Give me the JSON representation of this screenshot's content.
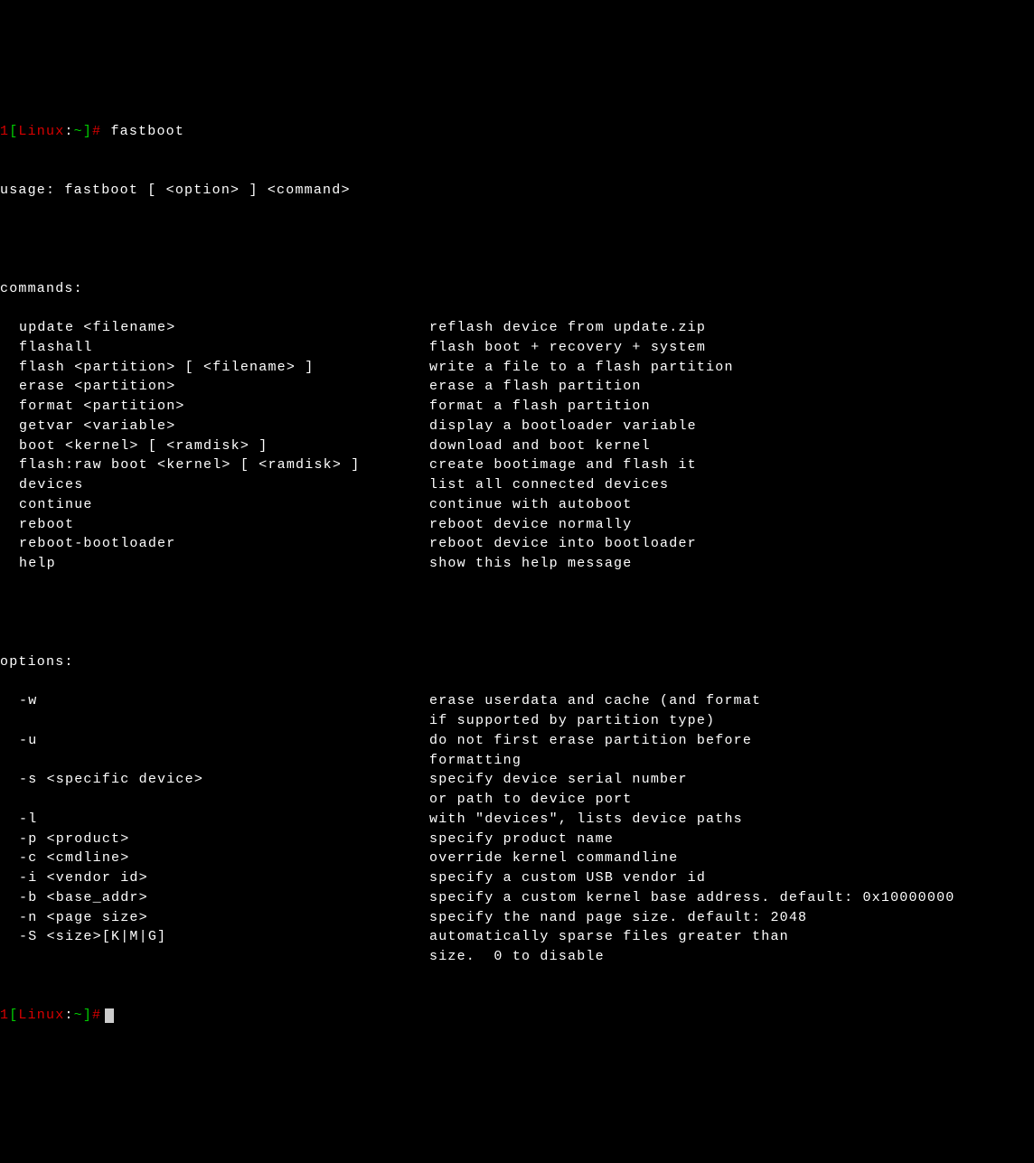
{
  "prompt": {
    "num": "1",
    "open": "[",
    "host": "Linux",
    "sep": ":",
    "path": "~",
    "close": "]",
    "hash": "#"
  },
  "cmd1": "fastboot",
  "usage": "usage: fastboot [ <option> ] <command>",
  "commands_header": "commands:",
  "commands": [
    {
      "left": "update <filename>",
      "right": "reflash device from update.zip"
    },
    {
      "left": "flashall",
      "right": "flash boot + recovery + system"
    },
    {
      "left": "flash <partition> [ <filename> ]",
      "right": "write a file to a flash partition"
    },
    {
      "left": "erase <partition>",
      "right": "erase a flash partition"
    },
    {
      "left": "format <partition>",
      "right": "format a flash partition"
    },
    {
      "left": "getvar <variable>",
      "right": "display a bootloader variable"
    },
    {
      "left": "boot <kernel> [ <ramdisk> ]",
      "right": "download and boot kernel"
    },
    {
      "left": "flash:raw boot <kernel> [ <ramdisk> ]",
      "right": "create bootimage and flash it"
    },
    {
      "left": "devices",
      "right": "list all connected devices"
    },
    {
      "left": "continue",
      "right": "continue with autoboot"
    },
    {
      "left": "reboot",
      "right": "reboot device normally"
    },
    {
      "left": "reboot-bootloader",
      "right": "reboot device into bootloader"
    },
    {
      "left": "help",
      "right": "show this help message"
    }
  ],
  "options_header": "options:",
  "options": [
    {
      "left": "-w",
      "right": "erase userdata and cache (and format"
    },
    {
      "left": "",
      "right": "if supported by partition type)"
    },
    {
      "left": "-u",
      "right": "do not first erase partition before"
    },
    {
      "left": "",
      "right": "formatting"
    },
    {
      "left": "-s <specific device>",
      "right": "specify device serial number"
    },
    {
      "left": "",
      "right": "or path to device port"
    },
    {
      "left": "-l",
      "right": "with \"devices\", lists device paths"
    },
    {
      "left": "-p <product>",
      "right": "specify product name"
    },
    {
      "left": "-c <cmdline>",
      "right": "override kernel commandline"
    },
    {
      "left": "-i <vendor id>",
      "right": "specify a custom USB vendor id"
    },
    {
      "left": "-b <base_addr>",
      "right": "specify a custom kernel base address. default: 0x10000000"
    },
    {
      "left": "-n <page size>",
      "right": "specify the nand page size. default: 2048"
    },
    {
      "left": "-S <size>[K|M|G]",
      "right": "automatically sparse files greater than"
    },
    {
      "left": "",
      "right": "size.  0 to disable"
    }
  ]
}
